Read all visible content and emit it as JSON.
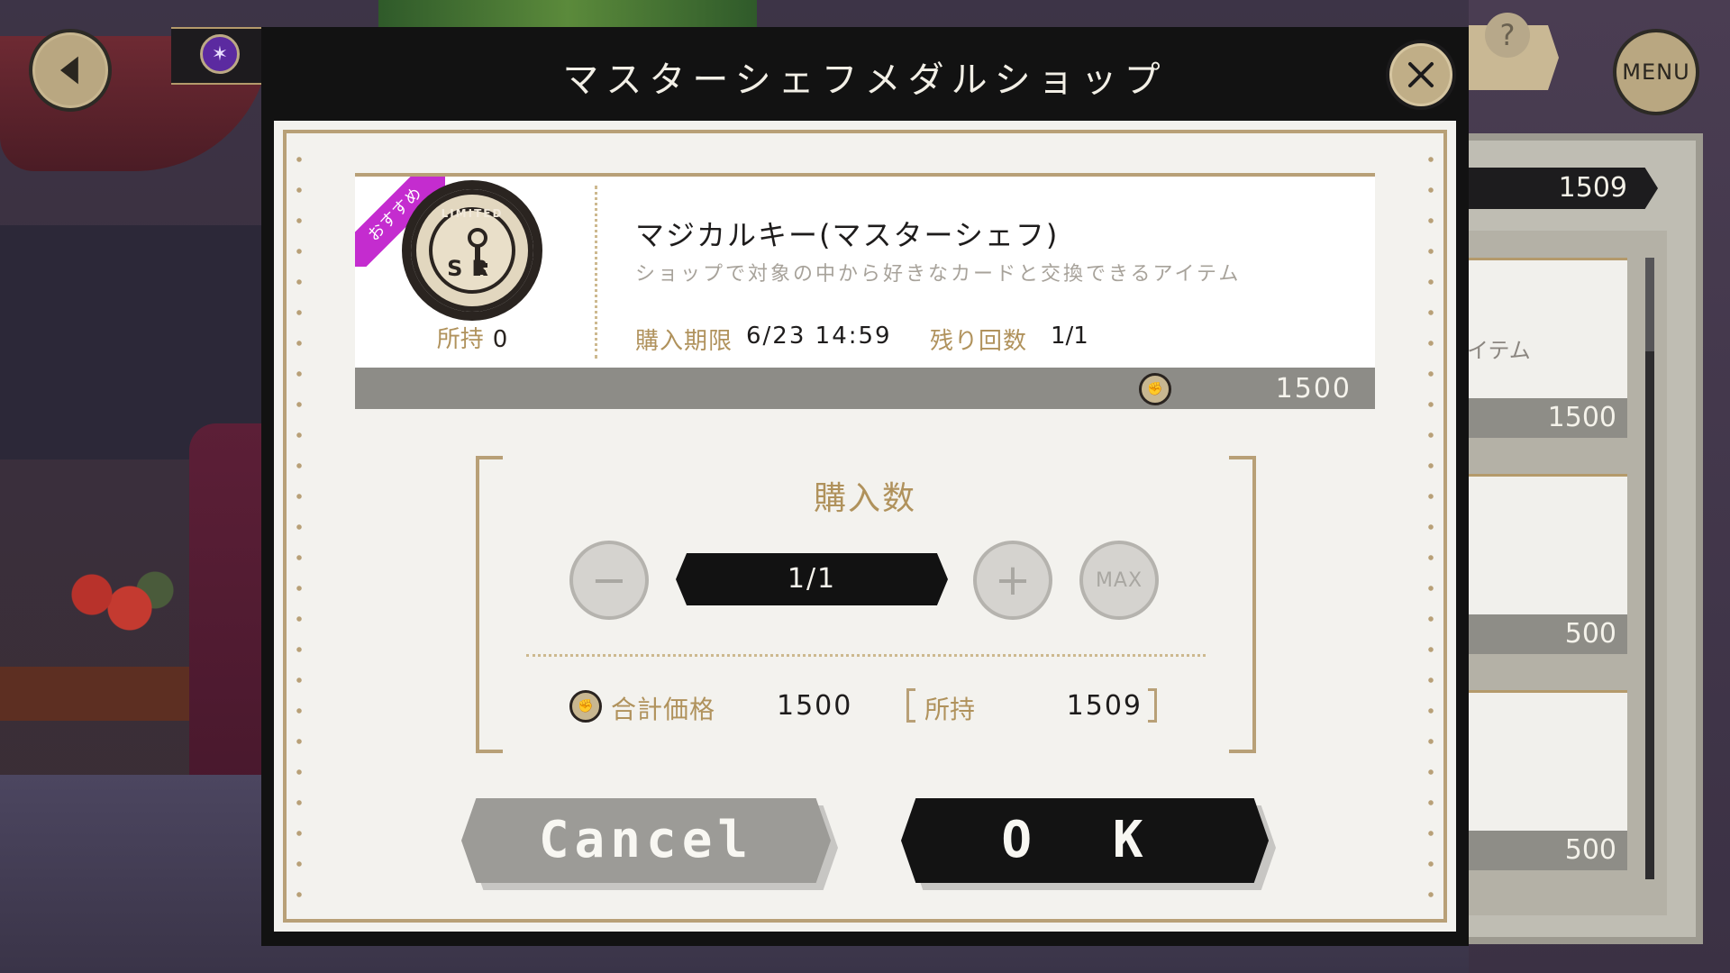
{
  "modal": {
    "title": "マスターシェフメダルショップ"
  },
  "item": {
    "badge": "おすすめ",
    "icon_ring_text": "LIMITED",
    "icon_grade": "SR",
    "owned_label": "所持",
    "owned_value": "0",
    "name": "マジカルキー(マスターシェフ)",
    "description": "ショップで対象の中から好きなカードと交換できるアイテム",
    "deadline_label": "購入期限",
    "deadline_value": "6/23 14:59",
    "remaining_label": "残り回数",
    "remaining_value": "1/1",
    "price": "1500"
  },
  "quantity": {
    "title": "購入数",
    "display": "1/1",
    "minus_symbol": "−",
    "plus_symbol": "+",
    "max_label": "MAX",
    "total_label": "合計価格",
    "total_value": "1500",
    "holding_label": "所持",
    "holding_value": "1509"
  },
  "buttons": {
    "cancel": "Cancel",
    "ok": "O K"
  },
  "hud": {
    "menu": "MENU",
    "help": "?"
  },
  "side_panel": {
    "balance": "1509",
    "cards": [
      {
        "label": "イテム",
        "price": "1500"
      },
      {
        "label": "",
        "price": "500"
      },
      {
        "label": "",
        "price": "500"
      }
    ]
  },
  "colors": {
    "gold": "#b8a077",
    "label_gold": "#b0925c",
    "badge": "#c42ccf",
    "dark": "#121212"
  },
  "icons": [
    "back-arrow-icon",
    "close-icon",
    "medal-coin-icon",
    "magical-key-icon",
    "help-icon"
  ]
}
